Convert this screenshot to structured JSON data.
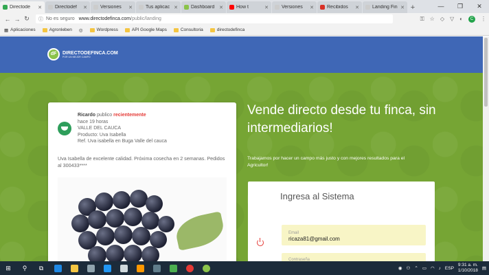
{
  "browser": {
    "tabs": [
      {
        "title": "Directode",
        "color": "#34a853",
        "active": true
      },
      {
        "title": "Directodef",
        "color": "#cccccc"
      },
      {
        "title": "Versiones",
        "color": "#cccccc"
      },
      {
        "title": "Tus aplicac",
        "color": "#cccccc"
      },
      {
        "title": "Dashboard",
        "color": "#8bc34a"
      },
      {
        "title": "How t",
        "color": "#ff0000"
      },
      {
        "title": "Versiones",
        "color": "#cccccc"
      },
      {
        "title": "Recibidos",
        "color": "#d93025"
      },
      {
        "title": "Landing Fin",
        "color": "#cccccc"
      }
    ],
    "omnibox": {
      "security": "No es seguro",
      "url_host": "www.directodefinca.com",
      "url_path": "/public/landing"
    },
    "bookmarks": [
      "Aplicaciones",
      "Agronleben",
      "Wordpress",
      "API Google Maps",
      "Consultoria",
      "directodefinca"
    ],
    "extension_letter": "C"
  },
  "site": {
    "logo_initials": "dF",
    "logo_name": "DIRECTODEFINCA.COM",
    "logo_tagline": "POR UN MEJOR CAMPO"
  },
  "post": {
    "author": "Ricardo",
    "publish_word": "publico",
    "recency": "recientemente",
    "time_ago": "hace 19 horas",
    "location": "VALLE DEL CAUCA",
    "product": "Producto: Uva Isabella",
    "reference": "Ref. Uva isabella en Buga Valle del cauca",
    "description": "Uva Isabella de excelente calidad. Próxima cosecha en 2 semanas. Pedidos al 300433****"
  },
  "hero": {
    "headline": "Vende directo desde tu finca, sin intermediarios!",
    "subtext": "Trabajamos por hacer un campo más justo y con mejores resultados para el Agricultor!"
  },
  "login": {
    "title": "Ingresa al Sistema",
    "email_label": "Email",
    "email_value": "ricaza81@gmail.com",
    "password_label": "Contraseña"
  },
  "taskbar": {
    "language": "ESP",
    "time": "9:31 a. m.",
    "date": "1/10/2018"
  }
}
